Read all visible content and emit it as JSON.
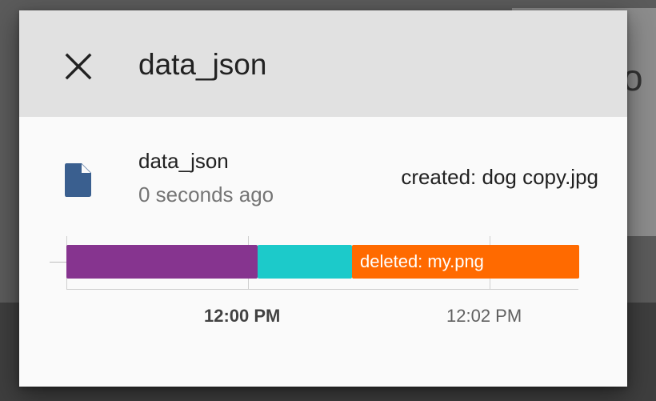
{
  "dialog": {
    "title": "data_json",
    "close_icon": "close-icon"
  },
  "entry": {
    "icon": "file-icon",
    "icon_color": "#3a5f8f",
    "name": "data_json",
    "time_ago": "0 seconds ago",
    "status": "created: dog copy.jpg"
  },
  "timeline": {
    "segments": [
      {
        "color": "#86348f",
        "label": ""
      },
      {
        "color": "#1ccaca",
        "label": ""
      },
      {
        "color": "#ff6a00",
        "label": "deleted: my.png"
      }
    ],
    "ticks": [
      {
        "label": "12:00 PM",
        "bold": true
      },
      {
        "label": "12:02 PM",
        "bold": false
      }
    ]
  },
  "background": {
    "partial_text": "ito"
  }
}
